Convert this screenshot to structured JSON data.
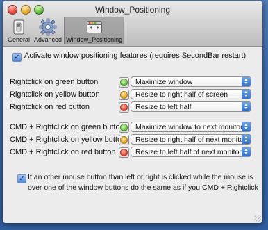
{
  "window": {
    "title": "Window_Positioning"
  },
  "toolbar": {
    "items": [
      {
        "label": "General",
        "icon": "switch-icon"
      },
      {
        "label": "Advanced",
        "icon": "gear-icon"
      },
      {
        "label": "Window_Positioning",
        "icon": "window-icon"
      }
    ],
    "selected": "Window_Positioning"
  },
  "settings": {
    "activate_label": "Activate window positioning features (requires SecondBar restart)",
    "activate_checked": true,
    "rows": [
      {
        "label": "Rightclick on green button",
        "button": "green",
        "action": "Maximize window"
      },
      {
        "label": "Rightclick on yellow button",
        "button": "yellow",
        "action": "Resize to right half of screen"
      },
      {
        "label": "Rightclick on red button",
        "button": "red",
        "action": "Resize to left half"
      },
      {
        "label": "CMD + Rightclick on green button",
        "button": "green",
        "action": "Maximize window to next monitor"
      },
      {
        "label": "CMD + Rightclick on yellow button",
        "button": "yellow",
        "action": "Resize to right half of next monitor"
      },
      {
        "label": "CMD + Rightclick on red button",
        "button": "red",
        "action": "Resize to left half of next monitor"
      }
    ],
    "other_mouse_label_line1": "If an other mouse button than left or right is clicked while the mouse is",
    "other_mouse_label_line2": "over one of the window buttons do the same as if you CMD + Rightclick",
    "other_mouse_checked": true
  },
  "colors": {
    "desktop": "#3b6aab",
    "window_bg": "#ececec",
    "accent": "#2e6fd0"
  }
}
